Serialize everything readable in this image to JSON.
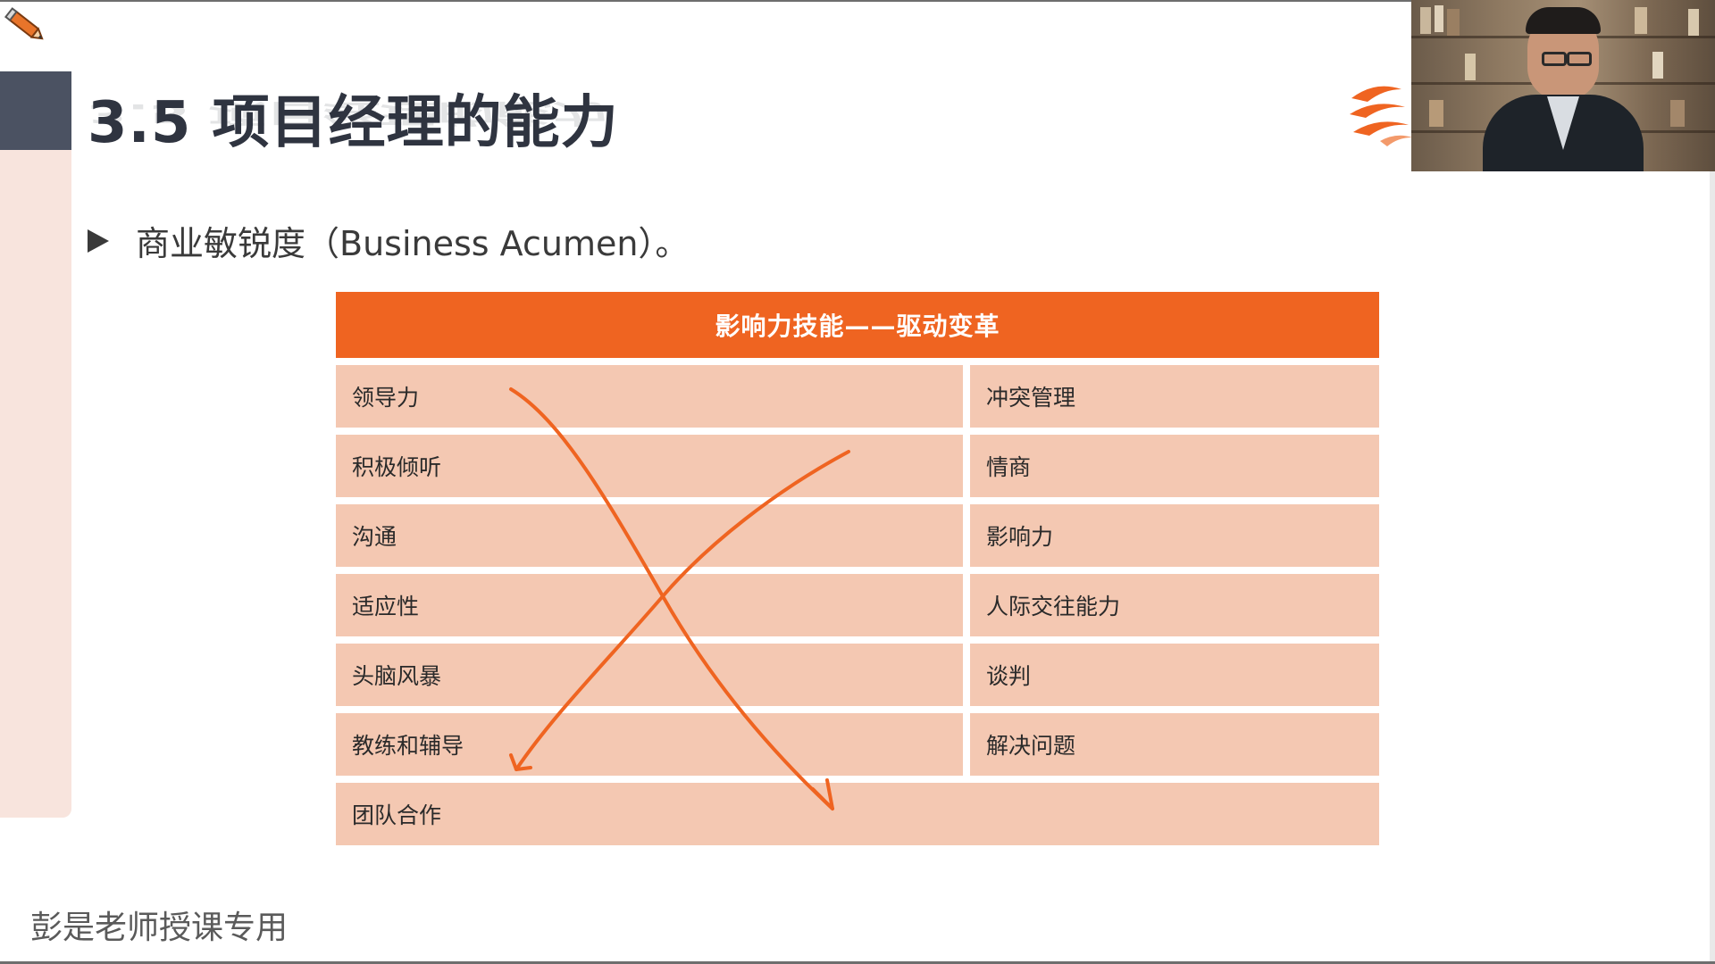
{
  "slide": {
    "title": "3.5 项目经理的能力",
    "bullet": "商业敏锐度（Business Acumen）。"
  },
  "table": {
    "header": "影响力技能——驱动变革",
    "rows": [
      {
        "left": "领导力",
        "right": "冲突管理"
      },
      {
        "left": "积极倾听",
        "right": "情商"
      },
      {
        "left": "沟通",
        "right": "影响力"
      },
      {
        "left": "适应性",
        "right": "人际交往能力"
      },
      {
        "left": "头脑风暴",
        "right": "谈判"
      },
      {
        "left": "教练和辅导",
        "right": "解决问题"
      }
    ],
    "last_row": "团队合作"
  },
  "watermark": "彭是老师授课专用",
  "colors": {
    "accent": "#ef6421",
    "cell": "#f4c8b2",
    "title": "#2f3440",
    "sidebar_dark": "#4b5262",
    "sidebar_light": "#f8e4dd"
  },
  "icons": [
    "pencil-icon",
    "logo-icon",
    "bullet-icon"
  ]
}
